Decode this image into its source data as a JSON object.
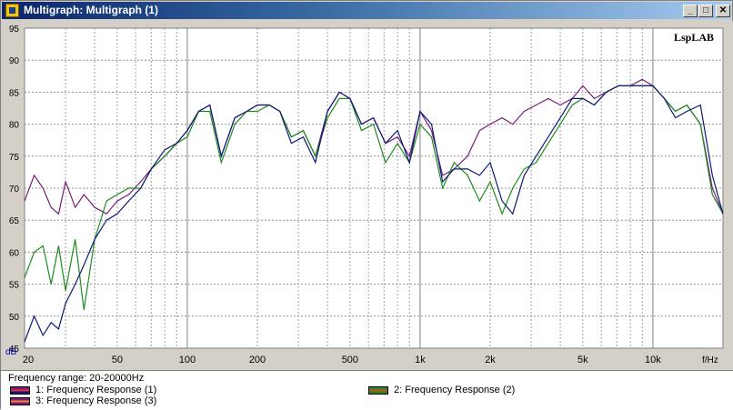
{
  "window": {
    "title": "Multigraph: Multigraph (1)",
    "buttons": {
      "minimize": "_",
      "maximize": "□",
      "close": "✕"
    }
  },
  "plot": {
    "watermark": "LspLAB",
    "y_unit": "dB",
    "x_unit": "f/Hz",
    "y_ticks": [
      "95",
      "90",
      "85",
      "80",
      "75",
      "70",
      "65",
      "60",
      "55",
      "50",
      "45"
    ],
    "x_ticks": [
      "20",
      "50",
      "100",
      "200",
      "500",
      "1k",
      "2k",
      "5k",
      "10k"
    ]
  },
  "legend": {
    "range": "Frequency range: 20-20000Hz",
    "entries": [
      {
        "label": "1: Frequency Response (1)",
        "colors": [
          "#7a1d78",
          "#0e1a7a"
        ]
      },
      {
        "label": "2: Frequency Response (2)",
        "colors": [
          "#1e8b1e",
          "#d44a1a"
        ]
      },
      {
        "label": "3: Frequency Response (3)",
        "colors": [
          "#7a1d78",
          "#f08a30"
        ]
      }
    ]
  },
  "chart_data": {
    "type": "line",
    "title": "",
    "xlabel": "f/Hz",
    "ylabel": "dB",
    "xscale": "log",
    "xlim": [
      20,
      20000
    ],
    "ylim": [
      45,
      95
    ],
    "grid": true,
    "legend_position": "bottom",
    "series": [
      {
        "name": "1: Frequency Response (1)",
        "color": "#0e1a7a",
        "x": [
          20,
          22,
          24,
          26,
          28,
          30,
          33,
          36,
          40,
          45,
          50,
          56,
          63,
          70,
          80,
          90,
          100,
          112,
          125,
          140,
          160,
          180,
          200,
          225,
          250,
          280,
          315,
          355,
          400,
          450,
          500,
          560,
          630,
          710,
          800,
          900,
          1000,
          1120,
          1250,
          1400,
          1600,
          1800,
          2000,
          2250,
          2500,
          2800,
          3150,
          3550,
          4000,
          4500,
          5000,
          5600,
          6300,
          7100,
          8000,
          9000,
          10000,
          11200,
          12500,
          14000,
          16000,
          18000,
          20000
        ],
        "y": [
          46,
          50,
          47,
          49,
          48,
          52,
          55,
          58,
          62,
          65,
          66,
          68,
          70,
          73,
          76,
          77,
          79,
          82,
          83,
          75,
          81,
          82,
          83,
          83,
          82,
          77,
          78,
          74,
          82,
          85,
          84,
          80,
          81,
          77,
          79,
          74,
          82,
          80,
          71,
          73,
          73,
          72,
          74,
          68,
          66,
          72,
          75,
          78,
          81,
          84,
          84,
          83,
          85,
          86,
          86,
          86,
          86,
          84,
          81,
          82,
          83,
          72,
          66
        ]
      },
      {
        "name": "2: Frequency Response (2)",
        "color": "#1e8b1e",
        "x": [
          20,
          22,
          24,
          26,
          28,
          30,
          33,
          36,
          40,
          45,
          50,
          56,
          63,
          70,
          80,
          90,
          100,
          112,
          125,
          140,
          160,
          180,
          200,
          225,
          250,
          280,
          315,
          355,
          400,
          450,
          500,
          560,
          630,
          710,
          800,
          900,
          1000,
          1120,
          1250,
          1400,
          1600,
          1800,
          2000,
          2250,
          2500,
          2800,
          3150,
          3550,
          4000,
          4500,
          5000,
          5600,
          6300,
          7100,
          8000,
          9000,
          10000,
          11200,
          12500,
          14000,
          16000,
          18000,
          20000
        ],
        "y": [
          56,
          60,
          61,
          55,
          61,
          54,
          62,
          51,
          62,
          68,
          69,
          70,
          70,
          73,
          75,
          77,
          78,
          82,
          82,
          74,
          80,
          82,
          82,
          83,
          82,
          78,
          79,
          75,
          81,
          84,
          84,
          79,
          80,
          74,
          77,
          74,
          80,
          78,
          70,
          74,
          72,
          68,
          71,
          66,
          70,
          73,
          74,
          77,
          80,
          83,
          84,
          83,
          85,
          86,
          86,
          86,
          86,
          84,
          82,
          83,
          80,
          69,
          66
        ]
      },
      {
        "name": "3: Frequency Response (3)",
        "color": "#7a1d78",
        "x": [
          20,
          22,
          24,
          26,
          28,
          30,
          33,
          36,
          40,
          45,
          50,
          56,
          63,
          70,
          80,
          90,
          100,
          112,
          125,
          140,
          160,
          180,
          200,
          225,
          250,
          280,
          315,
          355,
          400,
          450,
          500,
          560,
          630,
          710,
          800,
          900,
          1000,
          1120,
          1250,
          1400,
          1600,
          1800,
          2000,
          2250,
          2500,
          2800,
          3150,
          3550,
          4000,
          4500,
          5000,
          5600,
          6300,
          7100,
          8000,
          9000,
          10000,
          11200,
          12500,
          14000,
          16000,
          18000,
          20000
        ],
        "y": [
          68,
          72,
          70,
          67,
          66,
          71,
          67,
          69,
          67,
          66,
          68,
          69,
          71,
          73,
          75,
          77,
          79,
          82,
          83,
          75,
          81,
          82,
          83,
          83,
          82,
          78,
          79,
          75,
          82,
          85,
          84,
          80,
          81,
          77,
          78,
          75,
          82,
          79,
          72,
          73,
          75,
          79,
          80,
          81,
          80,
          82,
          83,
          84,
          83,
          84,
          86,
          84,
          85,
          86,
          86,
          87,
          86,
          84,
          82,
          83,
          80,
          70,
          66
        ]
      }
    ]
  }
}
